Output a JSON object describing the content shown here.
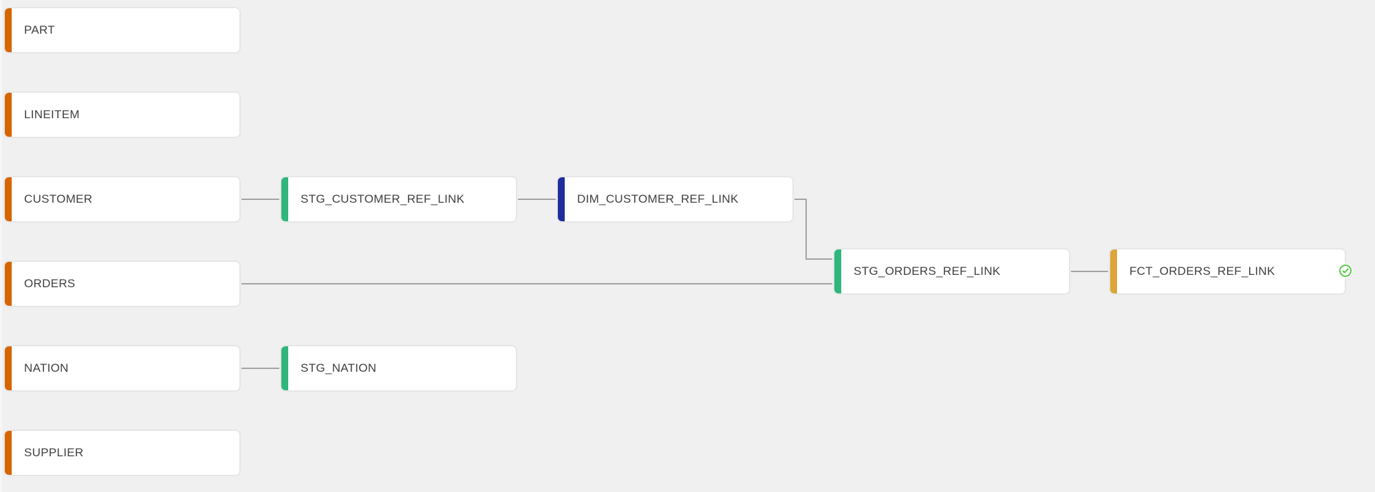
{
  "diagram": {
    "type": "lineage-graph",
    "colors": {
      "source": "#d66500",
      "staging": "#2fb67c",
      "dimension": "#1f2e9b",
      "fact": "#dca53a",
      "edge": "#a3a3a3",
      "status_ok": "#5cc949"
    },
    "nodes": [
      {
        "id": "PART",
        "label": "PART",
        "kind": "source"
      },
      {
        "id": "LINEITEM",
        "label": "LINEITEM",
        "kind": "source"
      },
      {
        "id": "CUSTOMER",
        "label": "CUSTOMER",
        "kind": "source"
      },
      {
        "id": "ORDERS",
        "label": "ORDERS",
        "kind": "source"
      },
      {
        "id": "NATION",
        "label": "NATION",
        "kind": "source"
      },
      {
        "id": "SUPPLIER",
        "label": "SUPPLIER",
        "kind": "source"
      },
      {
        "id": "STG_CUSTOMER_REF_LINK",
        "label": "STG_CUSTOMER_REF_LINK",
        "kind": "staging"
      },
      {
        "id": "STG_NATION",
        "label": "STG_NATION",
        "kind": "staging"
      },
      {
        "id": "DIM_CUSTOMER_REF_LINK",
        "label": "DIM_CUSTOMER_REF_LINK",
        "kind": "dimension"
      },
      {
        "id": "STG_ORDERS_REF_LINK",
        "label": "STG_ORDERS_REF_LINK",
        "kind": "staging"
      },
      {
        "id": "FCT_ORDERS_REF_LINK",
        "label": "FCT_ORDERS_REF_LINK",
        "kind": "fact",
        "status": "success"
      }
    ],
    "edges": [
      {
        "from": "CUSTOMER",
        "to": "STG_CUSTOMER_REF_LINK"
      },
      {
        "from": "STG_CUSTOMER_REF_LINK",
        "to": "DIM_CUSTOMER_REF_LINK"
      },
      {
        "from": "DIM_CUSTOMER_REF_LINK",
        "to": "STG_ORDERS_REF_LINK"
      },
      {
        "from": "ORDERS",
        "to": "STG_ORDERS_REF_LINK"
      },
      {
        "from": "NATION",
        "to": "STG_NATION"
      },
      {
        "from": "STG_ORDERS_REF_LINK",
        "to": "FCT_ORDERS_REF_LINK"
      }
    ]
  }
}
